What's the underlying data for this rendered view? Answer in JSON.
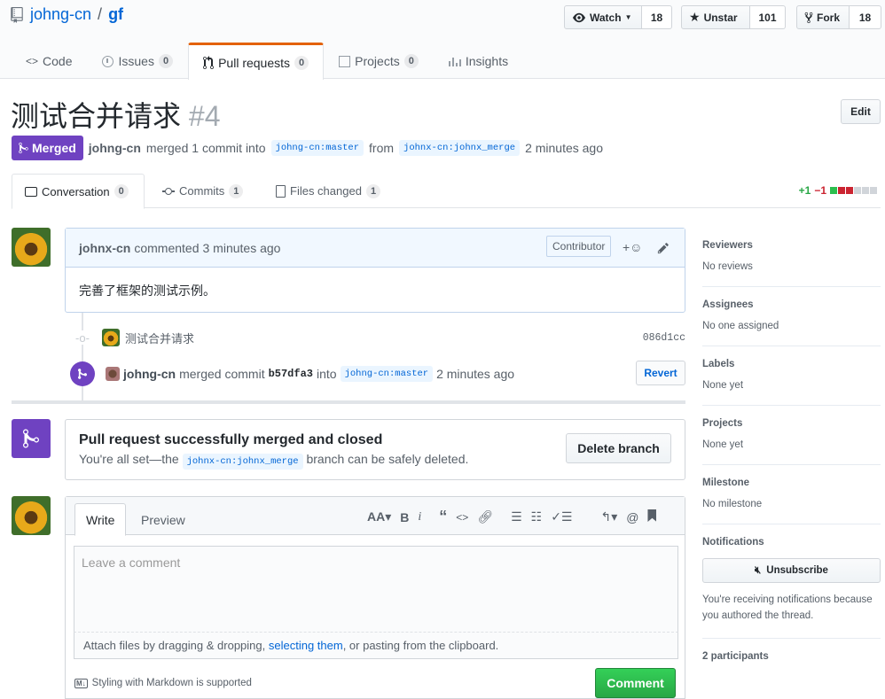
{
  "repo": {
    "owner": "johng-cn",
    "separator": "/",
    "name": "gf"
  },
  "actions": {
    "watch_label": "Watch",
    "watch_count": "18",
    "unstar_label": "Unstar",
    "star_count": "101",
    "fork_label": "Fork",
    "fork_count": "18"
  },
  "reponav": [
    {
      "label": "Code",
      "count": ""
    },
    {
      "label": "Issues",
      "count": "0"
    },
    {
      "label": "Pull requests",
      "count": "0"
    },
    {
      "label": "Projects",
      "count": "0"
    },
    {
      "label": "Insights",
      "count": ""
    }
  ],
  "pr": {
    "title": "测试合并请求",
    "number": "#4",
    "edit_label": "Edit",
    "state": "Merged",
    "merger": "johng-cn",
    "merge_text": "merged 1 commit into",
    "base_branch": "johng-cn:master",
    "from_text": "from",
    "head_branch": "johnx-cn:johnx_merge",
    "time": "2 minutes ago"
  },
  "prtabs": [
    {
      "label": "Conversation",
      "count": "0"
    },
    {
      "label": "Commits",
      "count": "1"
    },
    {
      "label": "Files changed",
      "count": "1"
    }
  ],
  "diffstat": {
    "add": "+1",
    "del": "−1"
  },
  "comment": {
    "author": "johnx-cn",
    "action": "commented",
    "time": "3 minutes ago",
    "role": "Contributor",
    "body": "完善了框架的测试示例。"
  },
  "commit": {
    "message": "测试合并请求",
    "sha": "086d1cc"
  },
  "merge_event": {
    "actor": "johng-cn",
    "text": "merged commit",
    "sha": "b57dfa3",
    "into": "into",
    "branch": "johng-cn:master",
    "time": "2 minutes ago",
    "revert_label": "Revert"
  },
  "merged_box": {
    "title": "Pull request successfully merged and closed",
    "text_before": "You're all set—the",
    "branch": "johnx-cn:johnx_merge",
    "text_after": "branch can be safely deleted.",
    "delete_label": "Delete branch"
  },
  "form": {
    "write_tab": "Write",
    "preview_tab": "Preview",
    "placeholder": "Leave a comment",
    "attach_before": "Attach files by dragging & dropping,",
    "attach_link": "selecting them",
    "attach_after": ", or pasting from the clipboard.",
    "markdown_note": "Styling with Markdown is supported",
    "submit_label": "Comment"
  },
  "sidebar": {
    "reviewers_h": "Reviewers",
    "reviewers_v": "No reviews",
    "assignees_h": "Assignees",
    "assignees_v": "No one assigned",
    "labels_h": "Labels",
    "labels_v": "None yet",
    "projects_h": "Projects",
    "projects_v": "None yet",
    "milestone_h": "Milestone",
    "milestone_v": "No milestone",
    "notifications_h": "Notifications",
    "unsubscribe_label": "Unsubscribe",
    "notifications_note": "You're receiving notifications because you authored the thread.",
    "participants": "2 participants"
  },
  "colors": {
    "merged": "#6f42c1",
    "link": "#0366d6",
    "success": "#28a745",
    "danger": "#cb2431",
    "tab_accent": "#e36209"
  }
}
